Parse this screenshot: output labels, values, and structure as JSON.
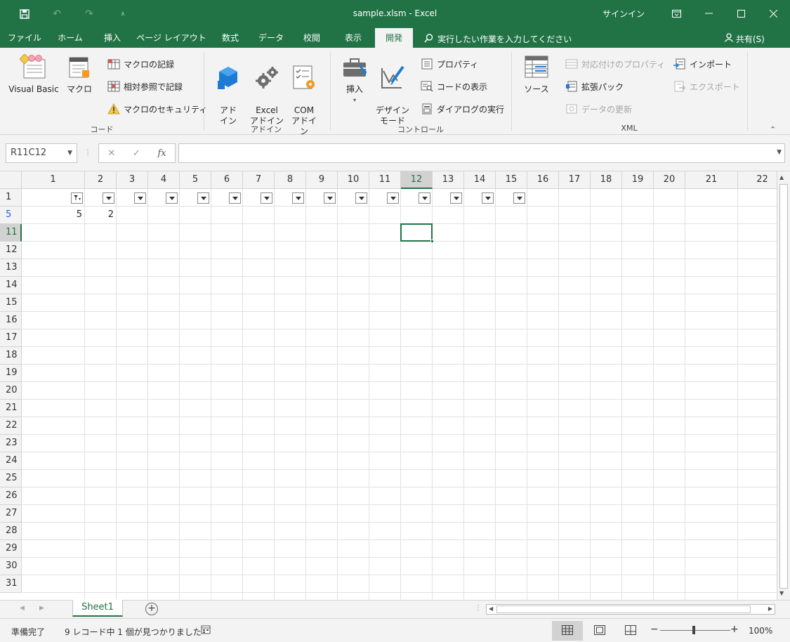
{
  "window": {
    "title": "sample.xlsm  -  Excel",
    "signin": "サインイン"
  },
  "qat": {
    "save_icon": "save-icon",
    "undo_icon": "undo-icon",
    "redo_icon": "redo-icon",
    "customize_icon": "qat-customize-icon"
  },
  "tabs": [
    {
      "label": "ファイル"
    },
    {
      "label": "ホーム"
    },
    {
      "label": "挿入"
    },
    {
      "label": "ページ レイアウト"
    },
    {
      "label": "数式"
    },
    {
      "label": "データ"
    },
    {
      "label": "校閲"
    },
    {
      "label": "表示"
    },
    {
      "label": "開発"
    }
  ],
  "active_tab": "開発",
  "tell_me": "実行したい作業を入力してください",
  "share": "共有(S)",
  "ribbon": {
    "code": {
      "label": "コード",
      "visual_basic": "Visual Basic",
      "macro": "マクロ",
      "record_macro": "マクロの記録",
      "relative_ref": "相対参照で記録",
      "macro_security": "マクロのセキュリティ"
    },
    "addins": {
      "label": "アドイン",
      "addin": "アド\nイン",
      "excel_addin": "Excel\nアドイン",
      "com_addin": "COM\nアドイン"
    },
    "controls": {
      "label": "コントロール",
      "insert": "挿入",
      "design_mode": "デザイン\nモード",
      "properties": "プロパティ",
      "view_code": "コードの表示",
      "run_dialog": "ダイアログの実行"
    },
    "xml": {
      "label": "XML",
      "source": "ソース",
      "map_properties": "対応付けのプロパティ",
      "expansion_packs": "拡張パック",
      "refresh_data": "データの更新",
      "import": "インポート",
      "export": "エクスポート"
    }
  },
  "formula_bar": {
    "name_box": "R11C12",
    "cancel": "✕",
    "enter": "✓",
    "fx": "fx",
    "formula": ""
  },
  "grid": {
    "columns": [
      "1",
      "2",
      "3",
      "4",
      "5",
      "6",
      "7",
      "8",
      "9",
      "10",
      "11",
      "12",
      "13",
      "14",
      "15",
      "16",
      "17",
      "18",
      "19",
      "20",
      "21",
      "22"
    ],
    "selected_column": "12",
    "rows": [
      "1",
      "5",
      "11",
      "12",
      "13",
      "14",
      "15",
      "16",
      "17",
      "18",
      "19",
      "20",
      "21",
      "22",
      "23",
      "24",
      "25",
      "26",
      "27",
      "28",
      "29",
      "30",
      "31"
    ],
    "filtered_rows": [
      "5"
    ],
    "selected_row": "11",
    "cells": [
      {
        "row": "5",
        "col": "1",
        "value": "5"
      },
      {
        "row": "5",
        "col": "2",
        "value": "2"
      }
    ],
    "filter_columns": [
      "1",
      "2",
      "3",
      "4",
      "5",
      "6",
      "7",
      "8",
      "9",
      "10",
      "11",
      "12",
      "13",
      "14",
      "15"
    ],
    "active_filter_column": "1"
  },
  "sheets": [
    {
      "name": "Sheet1",
      "active": true
    }
  ],
  "status": {
    "ready": "準備完了",
    "filter_info": "9 レコード中 1 個が見つかりました",
    "zoom": "100%",
    "zoom_minus": "−",
    "zoom_plus": "+"
  },
  "colors": {
    "accent": "#217346",
    "ribbon_bg": "#f3f3f3"
  }
}
